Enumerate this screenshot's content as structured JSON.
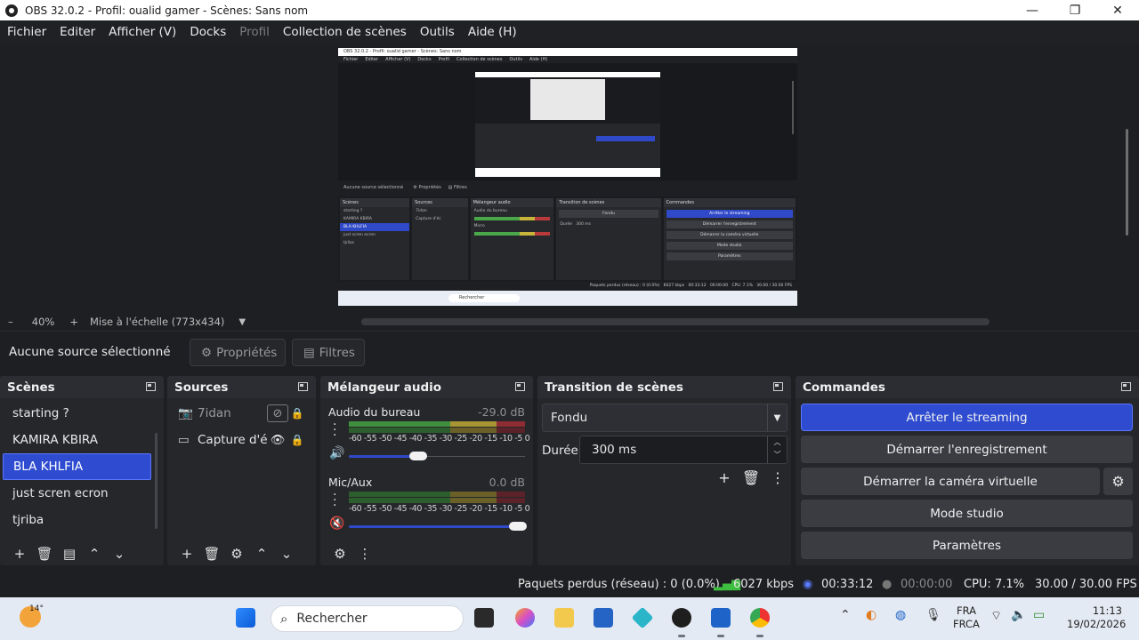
{
  "window": {
    "title": "OBS 32.0.2 - Profil: oualid gamer - Scènes: Sans nom"
  },
  "menu": [
    "Fichier",
    "Editer",
    "Afficher (V)",
    "Docks",
    "Profil",
    "Collection de scènes",
    "Outils",
    "Aide (H)"
  ],
  "preview": {
    "zoom_minus": "–",
    "zoom": "40%",
    "zoom_plus": "+",
    "scale_label": "Mise à l'échelle (773x434)"
  },
  "source_toolbar": {
    "no_source": "Aucune source sélectionné",
    "properties": "Propriétés",
    "filters": "Filtres"
  },
  "scenes": {
    "title": "Scènes",
    "items": [
      "starting ?",
      "KAMIRA KBIRA",
      "BLA KHLFIA",
      "just scren ecron",
      "tjriba"
    ],
    "selected": "BLA KHLFIA"
  },
  "sources": {
    "title": "Sources",
    "items": [
      {
        "name": "7idan",
        "icon": "camera-icon",
        "visible": false
      },
      {
        "name": "Capture d'écran",
        "icon": "monitor-icon",
        "visible": true
      }
    ]
  },
  "mixer": {
    "title": "Mélangeur audio",
    "ticks": "-60 -55 -50 -45 -40 -35 -30 -25 -20 -15 -10  -5   0",
    "tracks": [
      {
        "name": "Audio du bureau",
        "db": "-29.0 dB",
        "volume": 0.4,
        "muted": false
      },
      {
        "name": "Mic/Aux",
        "db": "0.0 dB",
        "volume": 1.0,
        "muted": true
      }
    ]
  },
  "transition": {
    "title": "Transition de scènes",
    "type": "Fondu",
    "duration_label": "Durée",
    "duration": "300 ms"
  },
  "commands": {
    "title": "Commandes",
    "stream": "Arrêter le streaming",
    "record": "Démarrer l'enregistrement",
    "virtualcam": "Démarrer la caméra virtuelle",
    "studio": "Mode studio",
    "settings": "Paramètres"
  },
  "status": {
    "dropped": "Paquets perdus (réseau) : 0 (0.0%)",
    "bitrate": "6027 kbps",
    "stream_time": "00:33:12",
    "rec_time": "00:00:00",
    "cpu": "CPU: 7.1%",
    "fps": "30.00 / 30.00 FPS"
  },
  "taskbar": {
    "temperature": "14°",
    "search_placeholder": "Rechercher",
    "lang_1": "FRA",
    "lang_2": "FRCA",
    "time": "11:13",
    "date": "19/02/2026"
  },
  "colors": {
    "accent": "#2f4cd0",
    "panel": "#25272b",
    "background": "#1e1f22"
  }
}
